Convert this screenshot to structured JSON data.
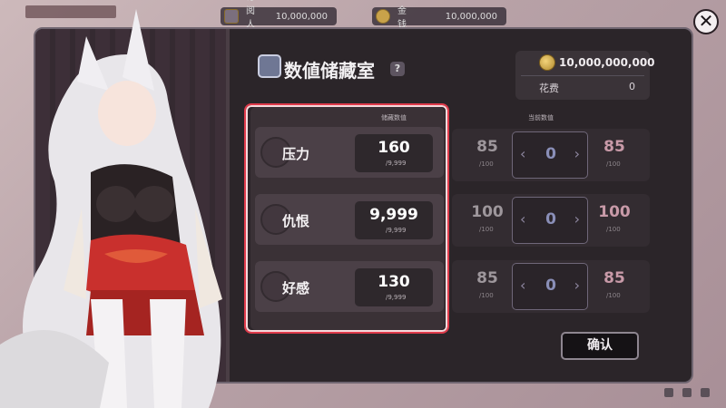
{
  "topbar": {
    "subscribers_label": "订阅人数",
    "subscribers_value": "10,000,000",
    "gold_label": "金钱",
    "gold_value": "10,000,000"
  },
  "title": "数値储藏室",
  "help": "?",
  "money": {
    "total": "10,000,000,000",
    "cost_label": "花费",
    "cost_value": "0"
  },
  "storage_header": "储藏数值",
  "current_header": "当前数值",
  "stats": [
    {
      "label": "压力",
      "stored": "160",
      "stored_max": "/9,999",
      "current": "85",
      "current_max": "/100",
      "adjust": "0",
      "new": "85",
      "new_max": "/100",
      "icon": "stress-icon"
    },
    {
      "label": "仇恨",
      "stored": "9,999",
      "stored_max": "/9,999",
      "current": "100",
      "current_max": "/100",
      "adjust": "0",
      "new": "100",
      "new_max": "/100",
      "icon": "hatred-icon"
    },
    {
      "label": "好感",
      "stored": "130",
      "stored_max": "/9,999",
      "current": "85",
      "current_max": "/100",
      "adjust": "0",
      "new": "85",
      "new_max": "/100",
      "icon": "heart-icon"
    }
  ],
  "confirm_label": "确认",
  "close_label": "✕",
  "colors": {
    "highlight_border": "#e03b4b",
    "panel_bg": "#2b2529"
  }
}
